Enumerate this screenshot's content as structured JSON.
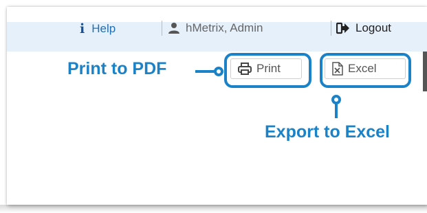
{
  "header": {
    "help_label": "Help",
    "user_label": "hMetrix, Admin",
    "logout_label": "Logout"
  },
  "toolbar": {
    "print_label": "Print",
    "excel_label": "Excel"
  },
  "annotations": {
    "print_callout": "Print to PDF",
    "excel_callout": "Export to Excel"
  },
  "colors": {
    "accent": "#1c82c8",
    "header_bg": "#e6f0fa",
    "link": "#1f6fb5"
  },
  "icons": [
    "info-icon",
    "user-icon",
    "logout-icon",
    "printer-icon",
    "excel-file-icon"
  ]
}
